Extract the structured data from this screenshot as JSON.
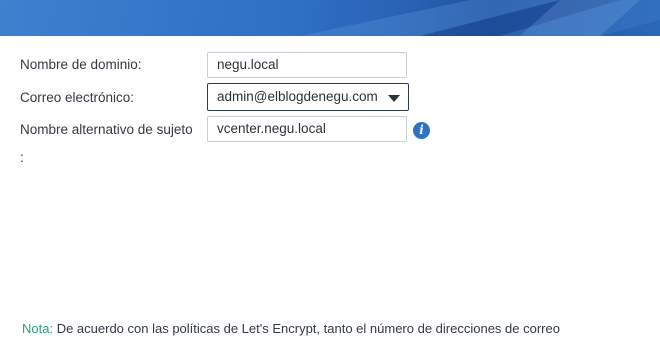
{
  "form": {
    "domain_label": "Nombre de dominio:",
    "domain_value": "negu.local",
    "email_label": "Correo electrónico:",
    "email_value": "admin@elblogdenegu.com",
    "san_label_line1": "Nombre alternativo de sujeto",
    "san_label_line2": ":",
    "san_value": "vcenter.negu.local"
  },
  "note": {
    "tag": "Nota:",
    "text": " De acuerdo con las políticas de Let's Encrypt, tanto el número de direcciones de correo"
  },
  "icons": {
    "info": "info-icon",
    "dropdown": "chevron-down-icon"
  },
  "colors": {
    "banner": "#2f6fc4",
    "accent": "#2f72c4",
    "note_tag": "#27a27a"
  }
}
